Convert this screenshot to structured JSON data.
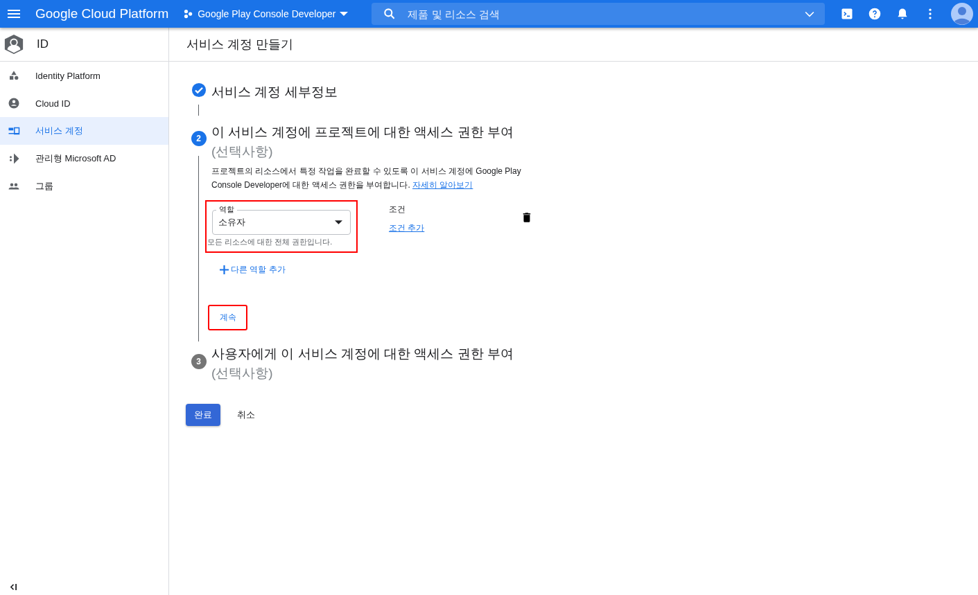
{
  "topbar": {
    "brand": "Google Cloud Platform",
    "project": "Google Play Console Developer",
    "search": {
      "placeholder": "제품 및 리소스 검색"
    }
  },
  "sidebar": {
    "title": "ID",
    "items": [
      {
        "label": "Identity Platform",
        "selected": false
      },
      {
        "label": "Cloud ID",
        "selected": false
      },
      {
        "label": "서비스 계정",
        "selected": true
      },
      {
        "label": "관리형 Microsoft AD",
        "selected": false
      },
      {
        "label": "그룹",
        "selected": false
      }
    ]
  },
  "page_title": "서비스 계정 만들기",
  "steps": [
    {
      "kind": "done",
      "title": "서비스 계정 세부정보"
    },
    {
      "kind": "active",
      "number": "2",
      "title": "이 서비스 계정에 프로젝트에 대한 액세스 권한 부여",
      "optional": "(선택사항)",
      "description": "프로젝트의 리소스에서 특정 작업을 완료할 수 있도록 이 서비스 계정에 Google Play Console Developer에 대한 액세스 권한을 부여합니다.",
      "link": "자세히 알아보기",
      "role": {
        "label": "역할",
        "value": "소유자",
        "hint": "모든 리소스에 대한 전체 권한입니다.",
        "highlighted": true
      },
      "condition": {
        "label": "조건",
        "link": "조건 추가"
      },
      "add_role": "다른 역할 추가",
      "continue": {
        "label": "계속",
        "highlighted": true
      }
    },
    {
      "kind": "pending",
      "number": "3",
      "title": "사용자에게 이 서비스 계정에 대한 액세스 권한 부여",
      "optional": "(선택사항)"
    }
  ],
  "actions": {
    "done": "완료",
    "cancel": "취소"
  }
}
